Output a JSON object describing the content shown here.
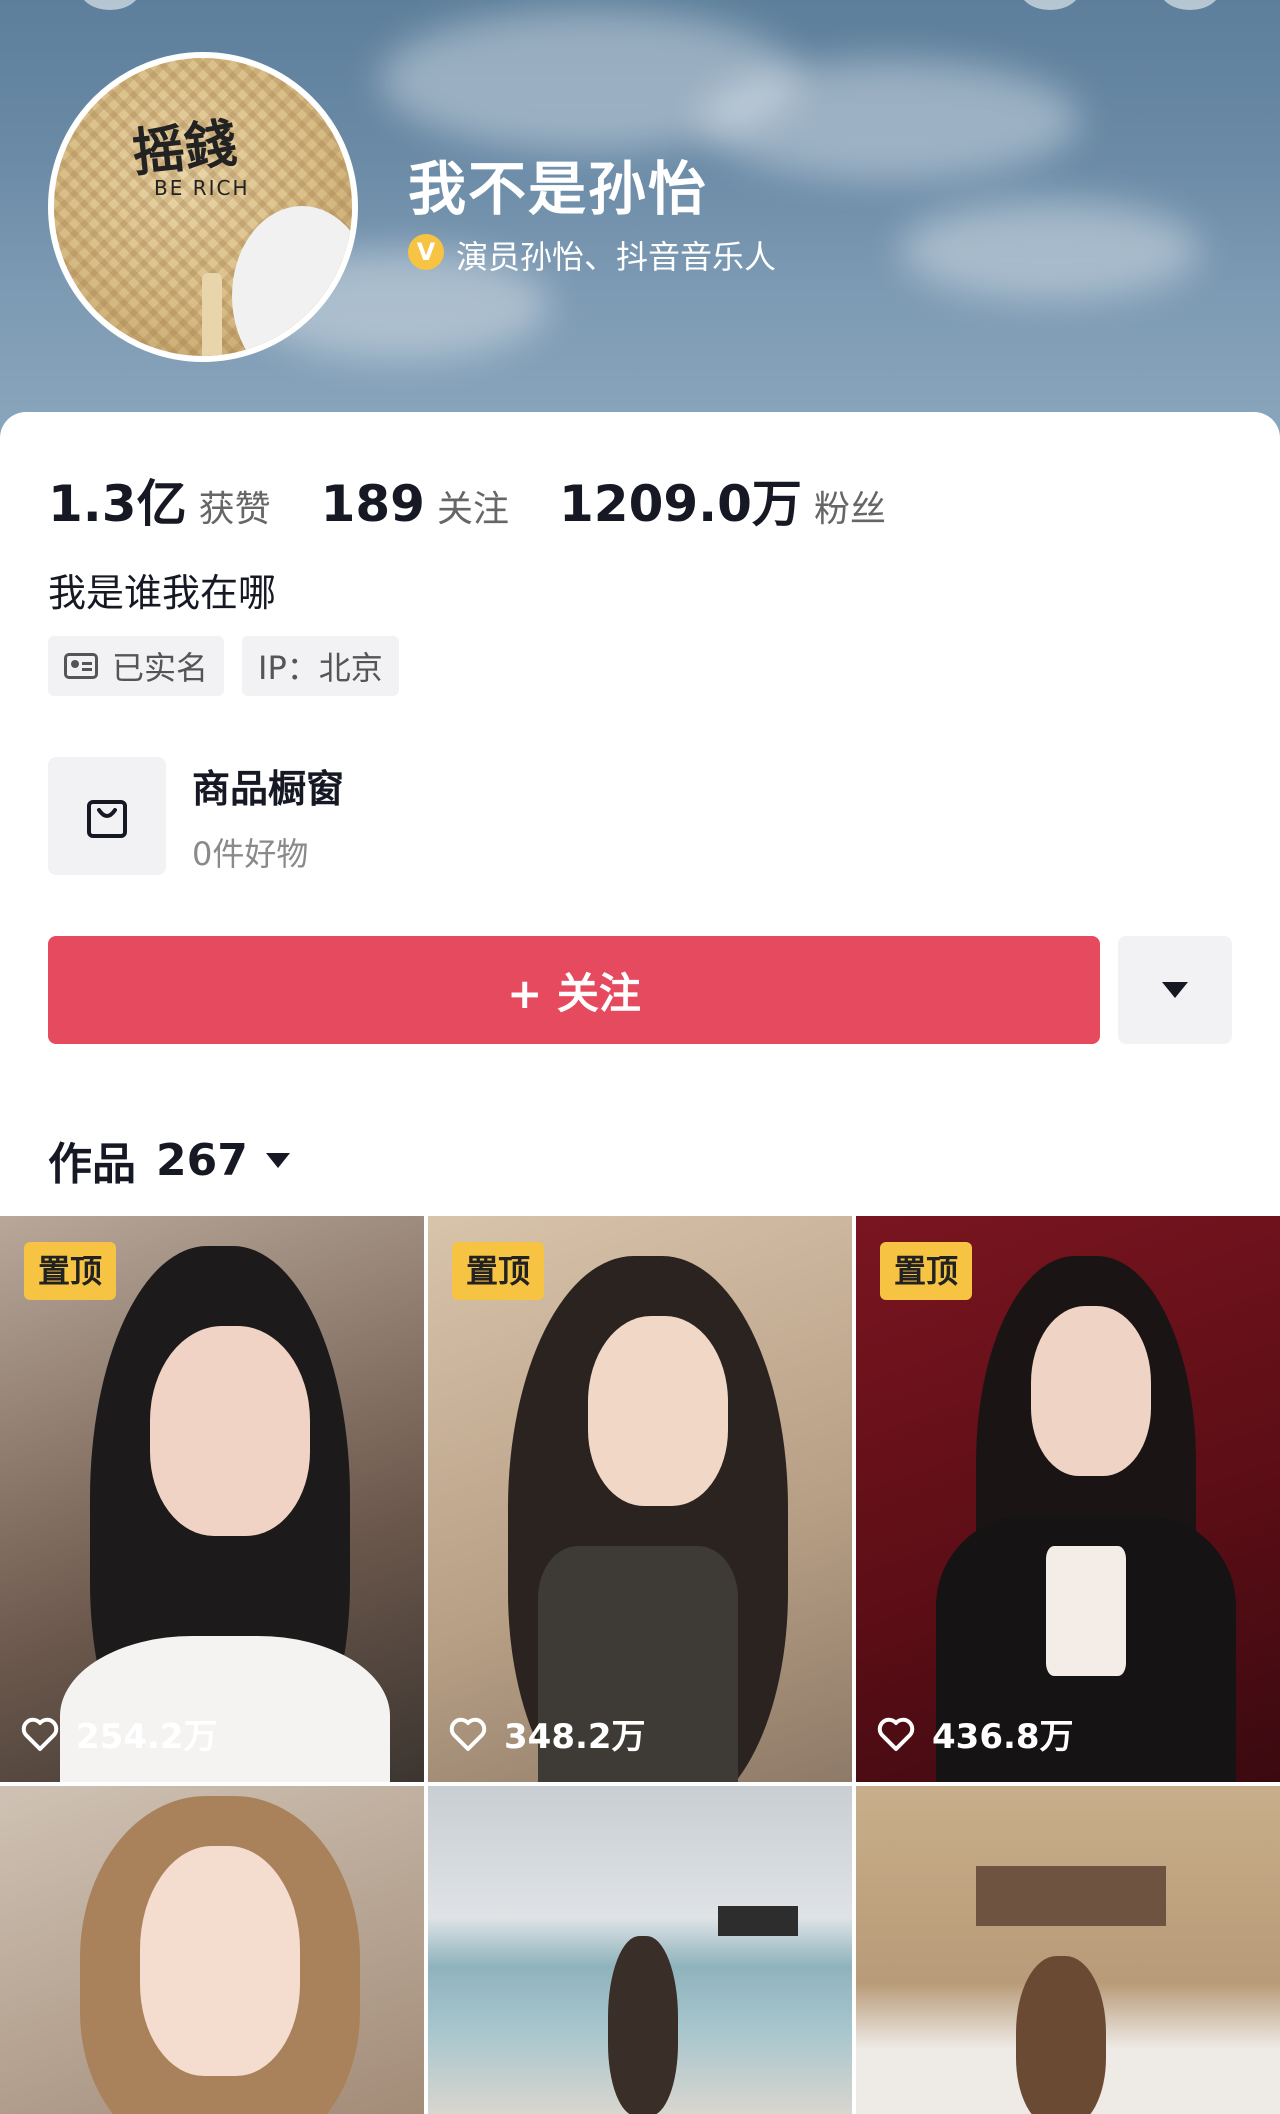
{
  "profile": {
    "name": "我不是孙怡",
    "verify_badge": "V",
    "verification": "演员孙怡、抖音音乐人",
    "avatar_text": "摇錢",
    "avatar_subtext": "BE RICH"
  },
  "stats": [
    {
      "value": "1.3亿",
      "label": "获赞"
    },
    {
      "value": "189",
      "label": "关注"
    },
    {
      "value": "1209.0万",
      "label": "粉丝"
    }
  ],
  "bio": "我是谁我在哪",
  "tags": {
    "realname": "已实名",
    "ip": "IP：北京"
  },
  "shop": {
    "title": "商品橱窗",
    "subtitle": "0件好物"
  },
  "actions": {
    "follow_label": "+ 关注"
  },
  "works": {
    "label": "作品",
    "count": "267"
  },
  "videos": [
    {
      "pinned": "置顶",
      "likes": "254.2万"
    },
    {
      "pinned": "置顶",
      "likes": "348.2万"
    },
    {
      "pinned": "置顶",
      "likes": "436.8万"
    },
    {
      "pinned": "",
      "likes": ""
    },
    {
      "pinned": "",
      "likes": ""
    },
    {
      "pinned": "",
      "likes": ""
    }
  ],
  "colors": {
    "follow": "#e64a5e",
    "pin": "#f6c343",
    "verify": "#f6c343"
  }
}
